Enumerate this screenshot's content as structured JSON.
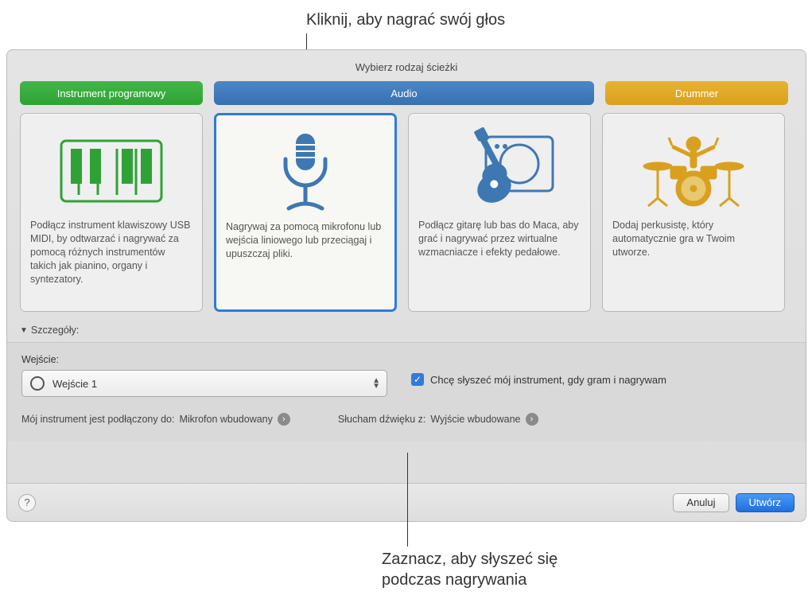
{
  "callouts": {
    "top": "Kliknij, aby nagrać swój głos",
    "bottom_line1": "Zaznacz, aby słyszeć się",
    "bottom_line2": "podczas nagrywania"
  },
  "title": "Wybierz rodzaj ścieżki",
  "tabs": {
    "software": "Instrument programowy",
    "audio": "Audio",
    "drummer": "Drummer"
  },
  "cards": {
    "keyboard_desc": "Podłącz instrument klawiszowy USB MIDI, by odtwarzać i nagrywać za pomocą różnych instrumentów takich jak pianino, organy i syntezatory.",
    "mic_desc": "Nagrywaj za pomocą mikrofonu lub wejścia liniowego lub przeciągaj i upuszczaj pliki.",
    "guitar_desc": "Podłącz gitarę lub bas do Maca, aby grać i nagrywać przez wirtualne wzmacniacze i efekty pedałowe.",
    "drummer_desc": "Dodaj perkusistę, który automatycznie gra w Twoim utworze."
  },
  "details": {
    "header": "Szczegóły:",
    "input_label": "Wejście:",
    "input_value": "Wejście 1",
    "monitor_label": "Chcę słyszeć mój instrument, gdy gram i nagrywam",
    "connected_prefix": "Mój instrument jest podłączony do: ",
    "connected_value": "Mikrofon wbudowany",
    "listen_prefix": "Słucham dźwięku z: ",
    "listen_value": "Wyjście wbudowane"
  },
  "footer": {
    "cancel": "Anuluj",
    "create": "Utwórz"
  }
}
